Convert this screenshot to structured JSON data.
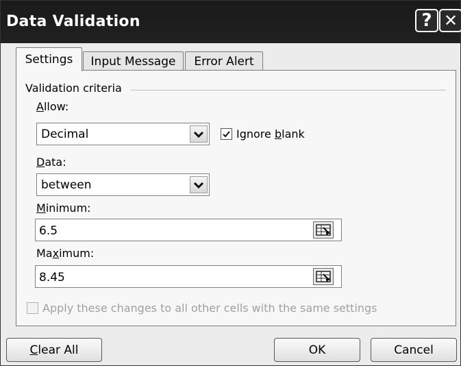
{
  "window": {
    "title": "Data Validation",
    "help_glyph": "?",
    "close_glyph": "✕"
  },
  "tabs": [
    {
      "label": "Settings",
      "active": true
    },
    {
      "label": "Input Message",
      "active": false
    },
    {
      "label": "Error Alert",
      "active": false
    }
  ],
  "criteria": {
    "group_label": "Validation criteria",
    "allow": {
      "label_pre": "",
      "label_key": "A",
      "label_post": "llow:",
      "value": "Decimal"
    },
    "ignore_blank": {
      "label_pre": "Ignore ",
      "label_key": "b",
      "label_post": "lank",
      "checked": true
    },
    "data": {
      "label_pre": "",
      "label_key": "D",
      "label_post": "ata:",
      "value": "between"
    },
    "minimum": {
      "label_pre": "",
      "label_key": "M",
      "label_post": "inimum:",
      "value": "6.5"
    },
    "maximum": {
      "label_pre": "Ma",
      "label_key": "x",
      "label_post": "imum:",
      "value": "8.45"
    }
  },
  "apply_all": {
    "label": "Apply these changes to all other cells with the same settings",
    "checked": false,
    "enabled": false
  },
  "buttons": {
    "clear_all": {
      "key": "C",
      "rest": "lear All"
    },
    "ok": "OK",
    "cancel": "Cancel"
  }
}
